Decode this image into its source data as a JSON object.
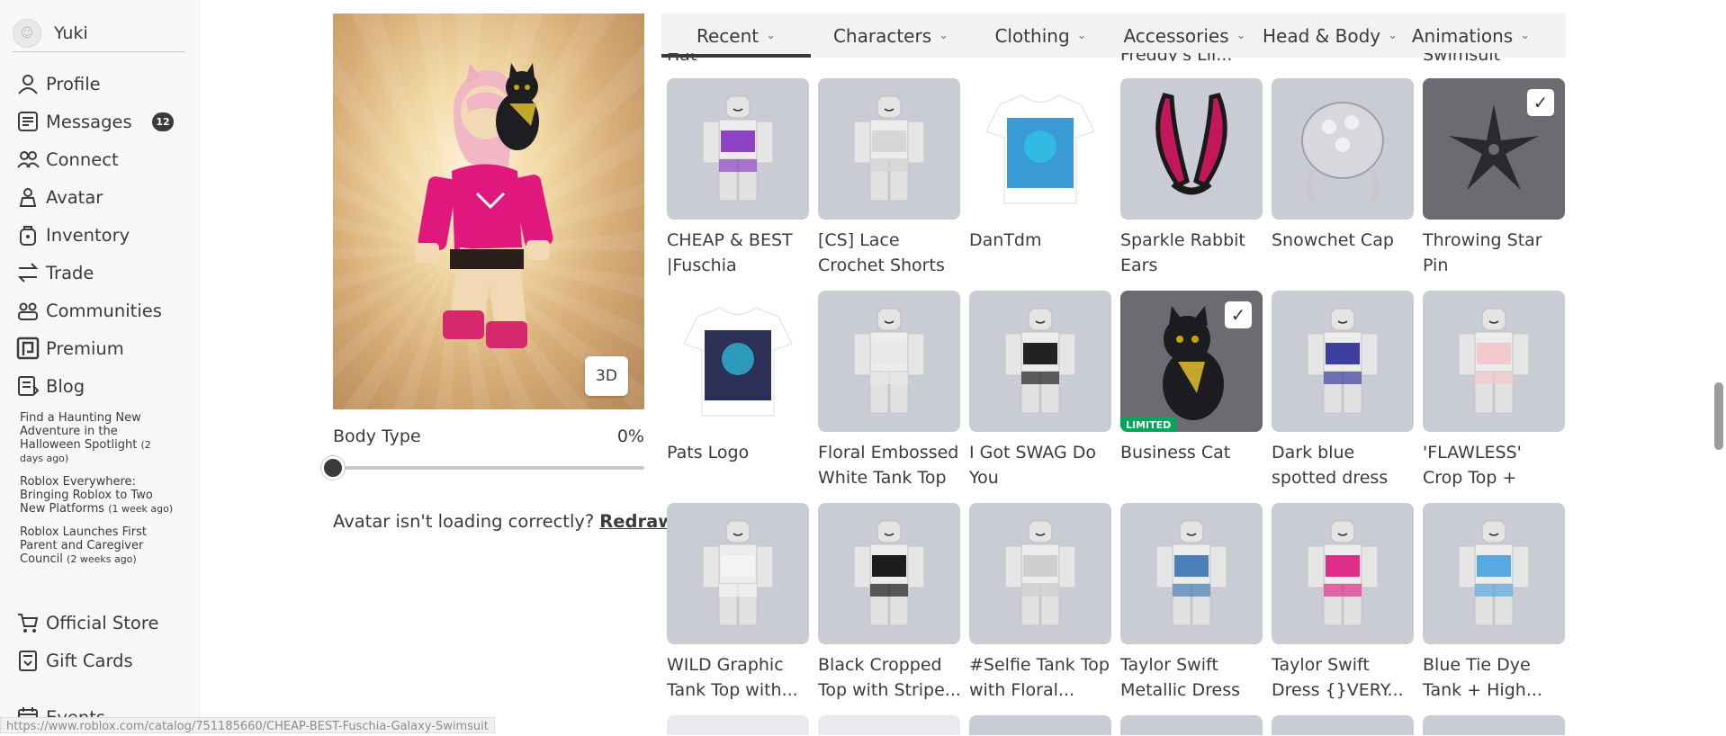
{
  "user": {
    "name": "Yuki"
  },
  "nav": [
    {
      "label": "Profile",
      "icon": "profile-icon"
    },
    {
      "label": "Messages",
      "icon": "messages-icon",
      "badge": "12"
    },
    {
      "label": "Connect",
      "icon": "connect-icon"
    },
    {
      "label": "Avatar",
      "icon": "avatar-icon"
    },
    {
      "label": "Inventory",
      "icon": "inventory-icon"
    },
    {
      "label": "Trade",
      "icon": "trade-icon"
    },
    {
      "label": "Communities",
      "icon": "communities-icon"
    },
    {
      "label": "Premium",
      "icon": "premium-icon"
    },
    {
      "label": "Blog",
      "icon": "blog-icon"
    }
  ],
  "blog_posts": [
    {
      "title": "Find a Haunting New Adventure in the Halloween Spotlight",
      "ago": "(2 days ago)"
    },
    {
      "title": "Roblox Everywhere: Bringing Roblox to Two New Platforms",
      "ago": "(1 week ago)"
    },
    {
      "title": "Roblox Launches First Parent and Caregiver Council",
      "ago": "(2 weeks ago)"
    }
  ],
  "nav_lower": [
    {
      "label": "Official Store",
      "icon": "cart-icon"
    },
    {
      "label": "Gift Cards",
      "icon": "gift-card-icon"
    }
  ],
  "nav_events": {
    "label": "Events",
    "icon": "calendar-icon"
  },
  "status_url": "https://www.roblox.com/catalog/751185660/CHEAP-BEST-Fuschia-Galaxy-Swimsuit",
  "preview": {
    "btn_3d": "3D",
    "body_type_label": "Body Type",
    "body_type_value": "0%",
    "body_type_fraction": 0,
    "loading_text": "Avatar isn't loading correctly?",
    "redraw_label": "Redraw"
  },
  "tabs": [
    {
      "label": "Recent",
      "active": true
    },
    {
      "label": "Characters"
    },
    {
      "label": "Clothing"
    },
    {
      "label": "Accessories"
    },
    {
      "label": "Head & Body"
    },
    {
      "label": "Animations"
    }
  ],
  "cut_names": [
    "Hat",
    "",
    "",
    "Freddy's Lil...",
    "",
    "Swimsuit"
  ],
  "items": [
    [
      {
        "name": "CHEAP & BEST |Fuschia Galaxy...",
        "thumb": "figure",
        "shirt": "#8e44c4"
      },
      {
        "name": "[CS] Lace Crochet Shorts",
        "thumb": "figure",
        "shirt": "#d6d6d6"
      },
      {
        "name": "DanTdm",
        "thumb": "tshirt",
        "art": "#3a9bd4"
      },
      {
        "name": "Sparkle Rabbit Ears",
        "thumb": "ears"
      },
      {
        "name": "Snowchet Cap",
        "thumb": "cap"
      },
      {
        "name": "Throwing Star Pin",
        "thumb": "star",
        "selected": true
      }
    ],
    [
      {
        "name": "Pats Logo",
        "thumb": "tshirt",
        "art": "#2c2f56"
      },
      {
        "name": "Floral Embossed White Tank Top",
        "thumb": "figure",
        "shirt": "#e8e8e8"
      },
      {
        "name": "I Got SWAG Do You",
        "thumb": "figure",
        "shirt": "#222222"
      },
      {
        "name": "Business Cat",
        "thumb": "cat",
        "selected": true,
        "limited": "LIMITED"
      },
      {
        "name": "Dark blue spotted dress",
        "thumb": "figure",
        "shirt": "#3d3fa0"
      },
      {
        "name": "'FLAWLESS' Crop Top + Floral Skirt",
        "thumb": "figure",
        "shirt": "#f2c9cf"
      }
    ],
    [
      {
        "name": "WILD Graphic Tank Top with...",
        "thumb": "figure",
        "shirt": "#f4f4f4"
      },
      {
        "name": "Black Cropped Top with Stripe...",
        "thumb": "figure",
        "shirt": "#1c1c1c"
      },
      {
        "name": "#Selfie Tank Top with Floral...",
        "thumb": "figure",
        "shirt": "#cfcfcf"
      },
      {
        "name": "Taylor Swift Metallic Dress",
        "thumb": "figure",
        "shirt": "#4a7fb8"
      },
      {
        "name": "Taylor Swift Dress {}VERY...",
        "thumb": "figure",
        "shirt": "#e02e8a"
      },
      {
        "name": "Blue Tie Dye Tank + High...",
        "thumb": "figure",
        "shirt": "#5aa8e0"
      }
    ]
  ]
}
